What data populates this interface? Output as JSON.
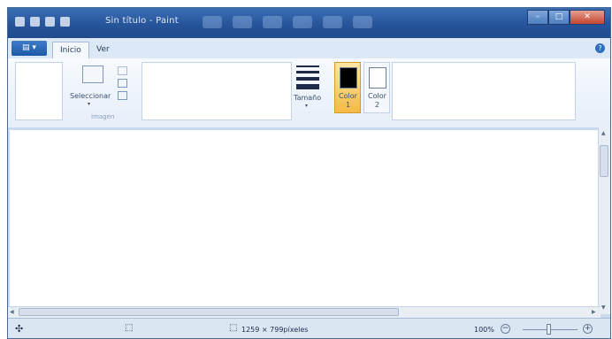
{
  "window": {
    "title": "Sin título - Paint",
    "colors": {
      "titlebar": "#27549a",
      "ribbon": "#e6eef8",
      "selected_color": "#f5b946"
    }
  },
  "menu_button": {
    "icon": "paint-menu-icon"
  },
  "tabs": [
    {
      "label": "Inicio",
      "active": true
    },
    {
      "label": "Ver",
      "active": false
    }
  ],
  "ribbon": {
    "image_group": {
      "select_label": "Seleccionar",
      "select_arrow": "▾",
      "group_label": "Imagen"
    },
    "size_label": "Tamaño",
    "size_arrow": "▾",
    "color1": {
      "line1": "Color",
      "line2": "1",
      "value": "#000000"
    },
    "color2": {
      "line1": "Color",
      "line2": "2",
      "value": "#ffffff"
    }
  },
  "statusbar": {
    "dimensions": "1259 × 799píxeles",
    "zoom": "100%",
    "zoom_minus": "−",
    "zoom_plus": "+"
  }
}
